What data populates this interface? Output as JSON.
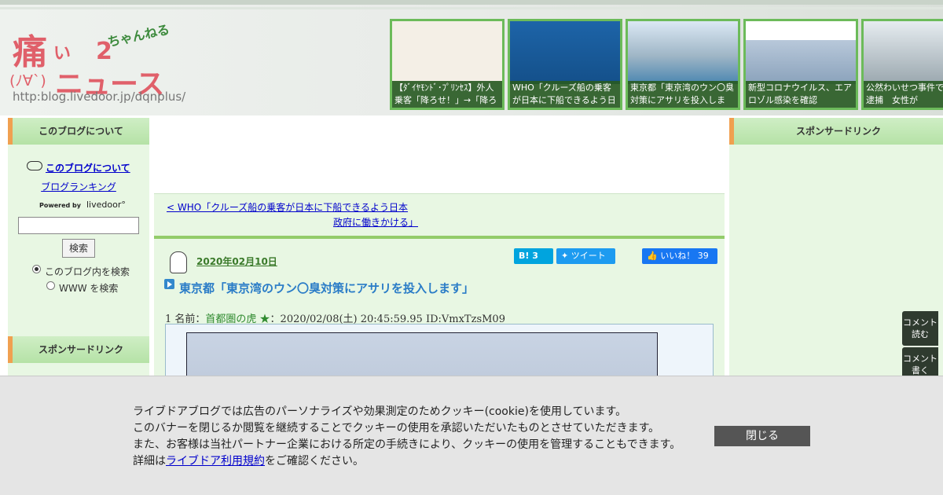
{
  "header": {
    "logo_main": "痛",
    "logo_i": "い",
    "logo_ni": "ちゃんねる",
    "logo_two": "2",
    "logo_face": "(ﾉ∀`)",
    "logo_news": "ニュース",
    "logo_url": "http:blog.livedoor.jp/dqnplus/"
  },
  "thumbnails": [
    {
      "caption": "【ﾀﾞｲﾔﾓﾝﾄﾞ･ﾌﾟﾘﾝｾｽ】外人乗客「降ろせ！」→「降ろさ",
      "img_color": "#f4efe6"
    },
    {
      "caption": "WHO「クルーズ船の乗客が日本に下船できるよう日",
      "img_color": "#1a5ea0"
    },
    {
      "caption": "東京都「東京湾のウン〇臭対策にアサリを投入しま",
      "img_color": "#6c9ec8"
    },
    {
      "caption": "新型コロナウイルス、エアロゾル感染を確認",
      "img_color": "#c9d6e6"
    },
    {
      "caption": "公然わいせつ事件でを誤認逮捕　女性が",
      "img_color": "#b7c2c9"
    }
  ],
  "left_column": {
    "about_head": "このブログについて",
    "about_icon": "( ˘ω˘ )",
    "about_link": "このブログについて",
    "ranking_link": "ブログランキング",
    "powered": "Powered by",
    "livedoor": "livedoor°",
    "search_button": "検索",
    "radio_blog": "このブログ内を検索",
    "radio_www": "WWW を検索",
    "sponsor_head": "スポンサードリンク"
  },
  "right_column": {
    "sponsor_head": "スポンサードリンク"
  },
  "navigation": {
    "prev_line1": "< WHO「クルーズ船の乗客が日本に下船できるよう日本",
    "prev_line2": "政府に働きかける」"
  },
  "article": {
    "date": "2020年02月10日",
    "hatena_label": "B! 3",
    "tweet_label": "ツイート",
    "like_label": "いいね！ 39",
    "title": "東京都「東京湾のウン〇臭対策にアサリを投入します」",
    "meta_prefix": "1 名前：",
    "poster": "首都圏の虎 ★",
    "meta_suffix": "：2020/02/08(土) 20:45:59.95 ID:VmxTzsM09"
  },
  "side_buttons": {
    "read_comments": "コメント読む",
    "write_comments": "コメント書く"
  },
  "cookie_banner": {
    "line1": "ライブドアブログでは広告のパーソナライズや効果測定のためクッキー(cookie)を使用しています。",
    "line2": "このバナーを閉じるか閲覧を継続することでクッキーの使用を承認いただいたものとさせていただきます。",
    "line3": "また、お客様は当社パートナー企業における所定の手続きにより、クッキーの使用を管理することもできます。",
    "line4_prefix": "詳細は",
    "line4_link": "ライブドア利用規約",
    "line4_suffix": "をご確認ください。",
    "close_button": "閉じる"
  }
}
